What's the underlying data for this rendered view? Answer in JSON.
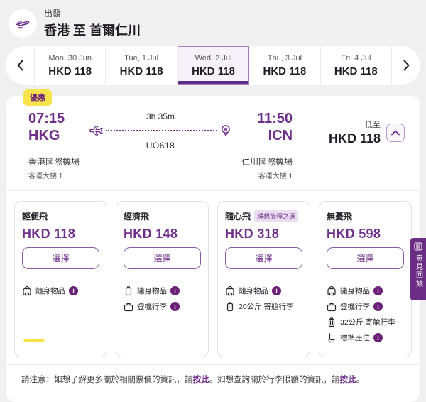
{
  "header": {
    "section_label": "出發",
    "route": "香港 至 首爾仁川"
  },
  "date_bar": {
    "days": [
      {
        "date": "Mon, 30 Jun",
        "price": "HKD 118",
        "selected": false
      },
      {
        "date": "Tue, 1 Jul",
        "price": "HKD 118",
        "selected": false
      },
      {
        "date": "Wed, 2 Jul",
        "price": "HKD 118",
        "selected": true
      },
      {
        "date": "Thu, 3 Jul",
        "price": "HKD 118",
        "selected": false
      },
      {
        "date": "Fri, 4 Jul",
        "price": "HKD 118",
        "selected": false
      }
    ]
  },
  "flight": {
    "promo_badge": "優惠",
    "departure": {
      "time": "07:15",
      "code": "HKG",
      "airport": "香港國際機場",
      "terminal": "客運大樓 1"
    },
    "arrival": {
      "time": "11:50",
      "code": "ICN",
      "airport": "仁川國際機場",
      "terminal": "客運大樓 1"
    },
    "duration": "3h 35m",
    "flight_number": "UO618",
    "price_prefix": "低至",
    "price": "HKD 118"
  },
  "fares": [
    {
      "name": "輕便飛",
      "price": "HKD 118",
      "select_label": "選擇",
      "items": [
        {
          "icon": "backpack-icon",
          "label": "隨身物品",
          "info": true
        }
      ]
    },
    {
      "name": "經濟飛",
      "price": "HKD 148",
      "select_label": "選擇",
      "items": [
        {
          "icon": "cabin-bag-icon",
          "label": "隨身物品",
          "info": true
        },
        {
          "icon": "briefcase-icon",
          "label": "登機行李",
          "info": true
        }
      ]
    },
    {
      "name": "隨心飛",
      "badge": "理想旅程之選",
      "price": "HKD 318",
      "select_label": "選擇",
      "items": [
        {
          "icon": "backpack-icon",
          "label": "隨身物品",
          "info": true
        },
        {
          "icon": "suitcase-icon",
          "label": "20公斤 寄艙行李",
          "info": false
        }
      ]
    },
    {
      "name": "無憂飛",
      "price": "HKD 598",
      "select_label": "選擇",
      "items": [
        {
          "icon": "backpack-icon",
          "label": "隨身物品",
          "info": true
        },
        {
          "icon": "briefcase-icon",
          "label": "登機行李",
          "info": true
        },
        {
          "icon": "suitcase-icon",
          "label": "32公斤 寄艙行李",
          "info": false
        },
        {
          "icon": "seat-icon",
          "label": "標準座位",
          "info": true
        }
      ]
    }
  ],
  "note": {
    "seg1": "請注意：如想了解更多關於相關票價的資訊，請",
    "link1": "按此",
    "seg2": "。如想查詢關於行李限額的資訊，請",
    "link2": "按此",
    "seg3": "。"
  },
  "feedback_tab": {
    "label": "意見回饋"
  },
  "colors": {
    "brand_purple": "#702f8a",
    "deep_purple": "#6b2077",
    "promo_yellow": "#f8e34d",
    "selected_day_border": "#a77bbf",
    "selected_day_underline": "#5d2e86"
  }
}
